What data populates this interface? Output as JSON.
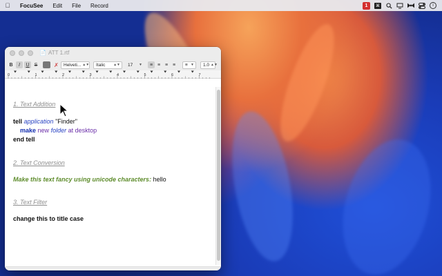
{
  "menubar": {
    "app_name": "FocuSee",
    "items": [
      "Edit",
      "File",
      "Record"
    ],
    "status_badge": "1"
  },
  "window": {
    "title": "ATT 1.rtf",
    "toolbar": {
      "bold": "B",
      "italic": "I",
      "underline": "U",
      "strikethrough": "S",
      "font_family": "Helveti...",
      "font_style": "Italic",
      "font_size": "17",
      "line_spacing": "1.0"
    },
    "ruler_marks": [
      "0",
      "1",
      "2",
      "3",
      "4",
      "5",
      "6",
      "7"
    ]
  },
  "document": {
    "section1_heading": "1. Text Addition",
    "code_tell": "tell",
    "code_application": "application",
    "code_finder": "\"Finder\"",
    "code_make": "make",
    "code_new": "new",
    "code_folder": "folder",
    "code_at_desktop": "at desktop",
    "code_end_tell": "end tell",
    "section2_heading": "2. Text Conversion",
    "fancy_prompt": "Make this text fancy using unicode characters:",
    "fancy_value": "hello",
    "section3_heading": "3. Text Filter",
    "title_case_text": "change this to title case"
  },
  "colors": {
    "keyword_blue": "#2a44c4",
    "prompt_green": "#5e8c2c",
    "heading_gray": "#8e8e8e"
  }
}
